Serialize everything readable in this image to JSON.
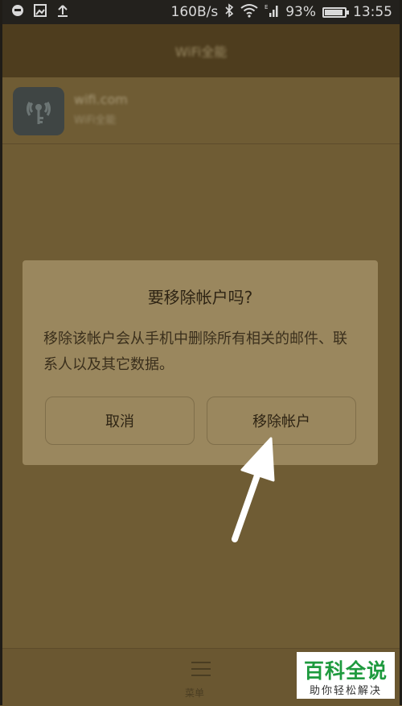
{
  "status_bar": {
    "net_speed": "160B/s",
    "battery": "93%",
    "time": "13:55",
    "signal_label": "E"
  },
  "app_bar": {
    "title": "WiFi全能"
  },
  "account": {
    "name": "wifi.com",
    "type": "WiFi全能"
  },
  "dialog": {
    "title": "要移除帐户吗?",
    "message": "移除该帐户会从手机中删除所有相关的邮件、联系人以及其它数据。",
    "cancel_label": "取消",
    "remove_label": "移除帐户"
  },
  "bottom_bar": {
    "menu_label": "菜单"
  },
  "watermark": {
    "title": "百科全说",
    "subtitle": "助你轻松解决"
  },
  "colors": {
    "brand_green": "#1e9a3e",
    "dim_background": "#6f5c34",
    "dialog": "#9a875e"
  }
}
